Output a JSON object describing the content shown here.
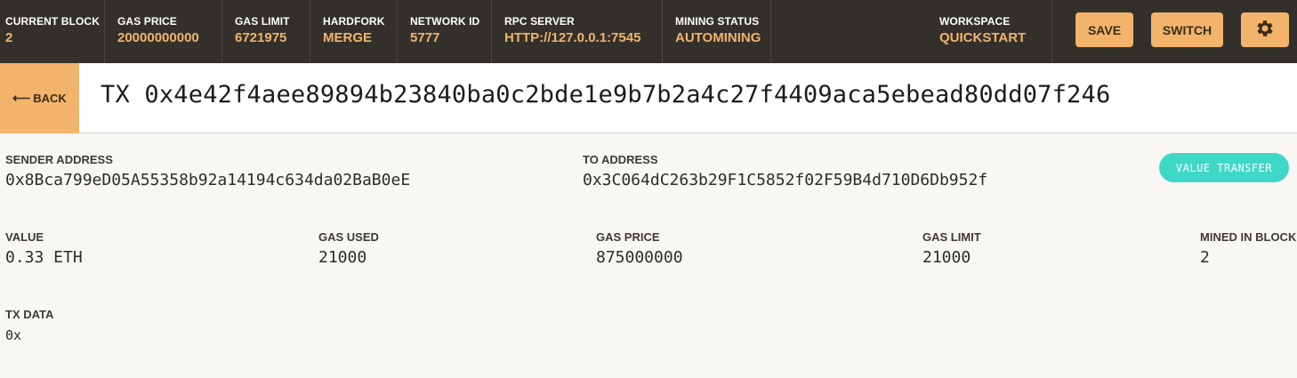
{
  "topbar": {
    "stats": [
      {
        "label": "CURRENT BLOCK",
        "value": "2"
      },
      {
        "label": "GAS PRICE",
        "value": "20000000000"
      },
      {
        "label": "GAS LIMIT",
        "value": "6721975"
      },
      {
        "label": "HARDFORK",
        "value": "MERGE"
      },
      {
        "label": "NETWORK ID",
        "value": "5777"
      },
      {
        "label": "RPC SERVER",
        "value": "HTTP://127.0.0.1:7545"
      },
      {
        "label": "MINING STATUS",
        "value": "AUTOMINING"
      }
    ],
    "workspace": {
      "label": "WORKSPACE",
      "value": "QUICKSTART"
    },
    "save_label": "SAVE",
    "switch_label": "SWITCH",
    "settings_icon": "gear-icon"
  },
  "titlebar": {
    "back_arrow": "⟵",
    "back_label": "BACK",
    "title": "TX 0x4e42f4aee89894b23840ba0c2bde1e9b7b2a4c27f4409aca5ebead80dd07f246"
  },
  "details": {
    "sender": {
      "label": "SENDER ADDRESS",
      "value": "0x8Bca799eD05A55358b92a14194c634da02BaB0eE"
    },
    "to": {
      "label": "TO ADDRESS",
      "value": "0x3C064dC263b29F1C5852f02F59B4d710D6Db952f"
    },
    "badge": "VALUE TRANSFER",
    "value": {
      "label": "VALUE",
      "value": "0.33 ETH"
    },
    "gas_used": {
      "label": "GAS USED",
      "value": "21000"
    },
    "gas_price": {
      "label": "GAS PRICE",
      "value": "875000000"
    },
    "gas_limit": {
      "label": "GAS LIMIT",
      "value": "21000"
    },
    "mined_in_block": {
      "label": "MINED IN BLOCK",
      "value": "2"
    },
    "tx_data": {
      "label": "TX DATA",
      "value": "0x"
    }
  },
  "colors": {
    "topbar_bg": "#33302c",
    "accent": "#f2b46b",
    "badge": "#3fd8c6",
    "page_bg": "#f8f7f4"
  }
}
